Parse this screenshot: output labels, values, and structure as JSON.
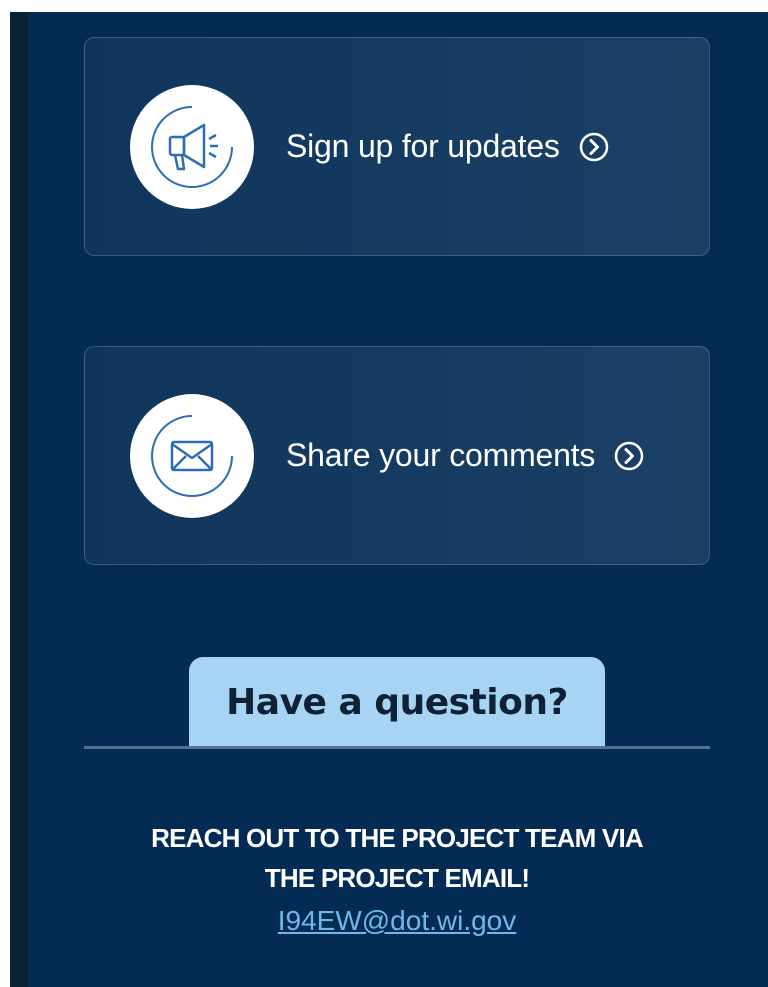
{
  "cards": [
    {
      "label": "Sign up for updates",
      "icon": "megaphone-icon"
    },
    {
      "label": "Share your comments",
      "icon": "envelope-icon"
    }
  ],
  "question_tab": {
    "label": "Have a question?"
  },
  "contact": {
    "line1": "REACH OUT TO THE PROJECT TEAM VIA",
    "line2": "THE PROJECT EMAIL!",
    "email": "I94EW@dot.wi.gov"
  },
  "colors": {
    "background": "#032b54",
    "card_border": "#2f5174",
    "tab_background": "#a6d4f2",
    "link": "#6fb9ea",
    "icon_stroke": "#2c6db3"
  }
}
